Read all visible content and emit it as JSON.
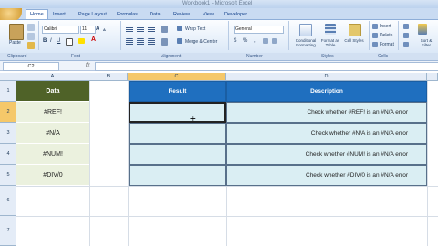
{
  "window": {
    "title": "Workbook1 - Microsoft Excel"
  },
  "tabs": [
    "Home",
    "Insert",
    "Page Layout",
    "Formulas",
    "Data",
    "Review",
    "View",
    "Developer"
  ],
  "ribbon": {
    "paste_label": "Paste",
    "font_name": "Calibri",
    "font_size": "11",
    "wrap_text": "Wrap Text",
    "merge_center": "Merge & Center",
    "number_format": "General",
    "conditional_formatting": "Conditional Formatting",
    "format_as_table": "Format as Table",
    "cell_styles": "Cell Styles",
    "insert": "Insert",
    "delete": "Delete",
    "format": "Format",
    "sort_filter": "Sort & Filter",
    "groups": [
      "Clipboard",
      "Font",
      "Alignment",
      "Number",
      "Styles",
      "Cells"
    ]
  },
  "formula_bar": {
    "name_box": "C2",
    "fx": "fx",
    "content": ""
  },
  "columns": [
    "A",
    "B",
    "C",
    "D"
  ],
  "rows": [
    "1",
    "2",
    "3",
    "4",
    "5",
    "6",
    "7"
  ],
  "sheet": {
    "headers": {
      "data": "Data",
      "result": "Result",
      "description": "Description"
    },
    "data": [
      "#REF!",
      "#N/A",
      "#NUM!",
      "#DIV/0"
    ],
    "descriptions": [
      "Check whether #REF! is an #N/A error",
      "Check whether #N/A is an #N/A error",
      "Check whether #NUM! is an #N/A error",
      "Check whether #DIV/0 is an #N/A error"
    ]
  },
  "colors": {
    "header_green": "#4f6228",
    "header_blue": "#1f6fbf",
    "cell_green": "#ebf1de",
    "cell_blue": "#daeef3"
  }
}
